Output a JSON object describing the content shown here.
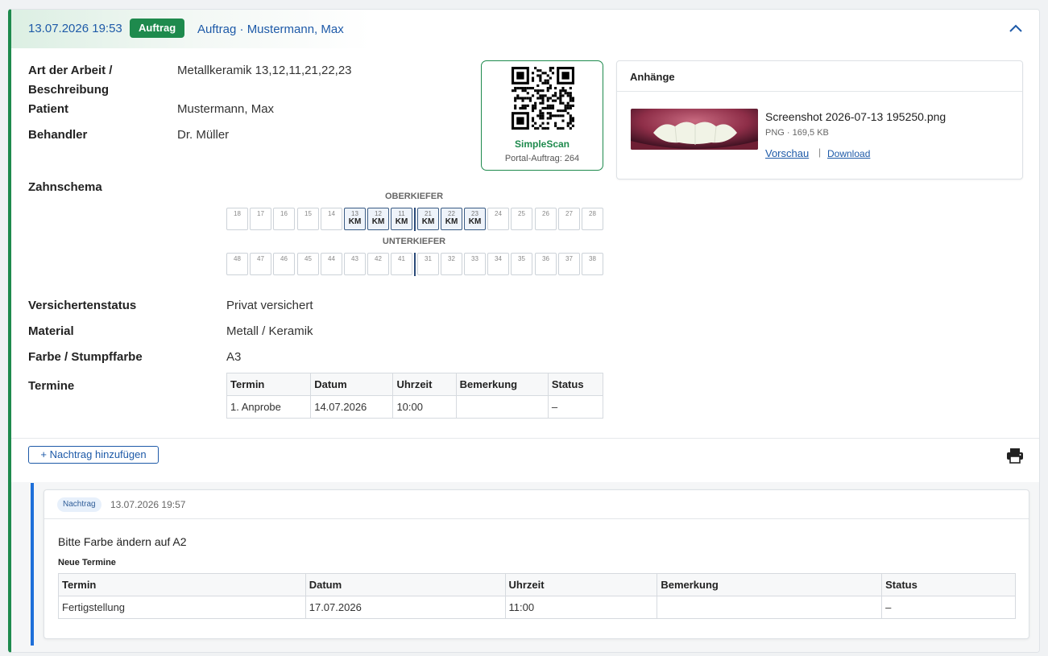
{
  "header": {
    "date": "13.07.2026 19:53",
    "badge": "Auftrag",
    "title": "Auftrag · Mustermann, Max",
    "accent": "#1e8a4d",
    "link_color": "#1e5aa8"
  },
  "details": {
    "art_label": "Art der Arbeit /",
    "art_label_2": "Beschreibung",
    "art_value": "Metallkeramik 13,12,11,21,22,23",
    "patient_label": "Patient",
    "patient_value": "Mustermann, Max",
    "behandler_label": "Behandler",
    "behandler_value": "Dr. Müller"
  },
  "qr": {
    "title": "SimpleScan",
    "subtitle": "Portal-Auftrag: 264"
  },
  "attachments": {
    "heading": "Anhänge",
    "file_name": "Screenshot 2026-07-13 195250.png",
    "file_meta": "PNG · 169,5 KB",
    "preview_label": "Vorschau",
    "separator": "|",
    "download_label": "Download"
  },
  "zahnschema": {
    "label": "Zahnschema",
    "upper_title": "OBERKIEFER",
    "lower_title": "UNTERKIEFER",
    "upper": [
      {
        "num": "18",
        "code": ""
      },
      {
        "num": "17",
        "code": ""
      },
      {
        "num": "16",
        "code": ""
      },
      {
        "num": "15",
        "code": ""
      },
      {
        "num": "14",
        "code": ""
      },
      {
        "num": "13",
        "code": "KM"
      },
      {
        "num": "12",
        "code": "KM"
      },
      {
        "num": "11",
        "code": "KM"
      },
      {
        "num": "21",
        "code": "KM"
      },
      {
        "num": "22",
        "code": "KM"
      },
      {
        "num": "23",
        "code": "KM"
      },
      {
        "num": "24",
        "code": ""
      },
      {
        "num": "25",
        "code": ""
      },
      {
        "num": "26",
        "code": ""
      },
      {
        "num": "27",
        "code": ""
      },
      {
        "num": "28",
        "code": ""
      }
    ],
    "lower": [
      {
        "num": "48",
        "code": ""
      },
      {
        "num": "47",
        "code": ""
      },
      {
        "num": "46",
        "code": ""
      },
      {
        "num": "45",
        "code": ""
      },
      {
        "num": "44",
        "code": ""
      },
      {
        "num": "43",
        "code": ""
      },
      {
        "num": "42",
        "code": ""
      },
      {
        "num": "41",
        "code": ""
      },
      {
        "num": "31",
        "code": ""
      },
      {
        "num": "32",
        "code": ""
      },
      {
        "num": "33",
        "code": ""
      },
      {
        "num": "34",
        "code": ""
      },
      {
        "num": "35",
        "code": ""
      },
      {
        "num": "36",
        "code": ""
      },
      {
        "num": "37",
        "code": ""
      },
      {
        "num": "38",
        "code": ""
      }
    ]
  },
  "info": {
    "versicherung_label": "Versichertenstatus",
    "versicherung_value": "Privat versichert",
    "material_label": "Material",
    "material_value": "Metall / Keramik",
    "farbe_label": "Farbe / Stumpffarbe",
    "farbe_value": "A3",
    "termine_label": "Termine"
  },
  "termine_table": {
    "headers": [
      "Termin",
      "Datum",
      "Uhrzeit",
      "Bemerkung",
      "Status"
    ],
    "rows": [
      [
        "1. Anprobe",
        "14.07.2026",
        "10:00",
        "",
        "–"
      ]
    ]
  },
  "actions": {
    "add_supplement": "+ Nachtrag hinzufügen"
  },
  "supplement": {
    "badge": "Nachtrag",
    "date": "13.07.2026 19:57",
    "text": "Bitte Farbe ändern auf A2",
    "subheading": "Neue Termine",
    "table_headers": [
      "Termin",
      "Datum",
      "Uhrzeit",
      "Bemerkung",
      "Status"
    ],
    "table_rows": [
      [
        "Fertigstellung",
        "17.07.2026",
        "11:00",
        "",
        "–"
      ]
    ],
    "bar_color": "#1e6fd9"
  }
}
